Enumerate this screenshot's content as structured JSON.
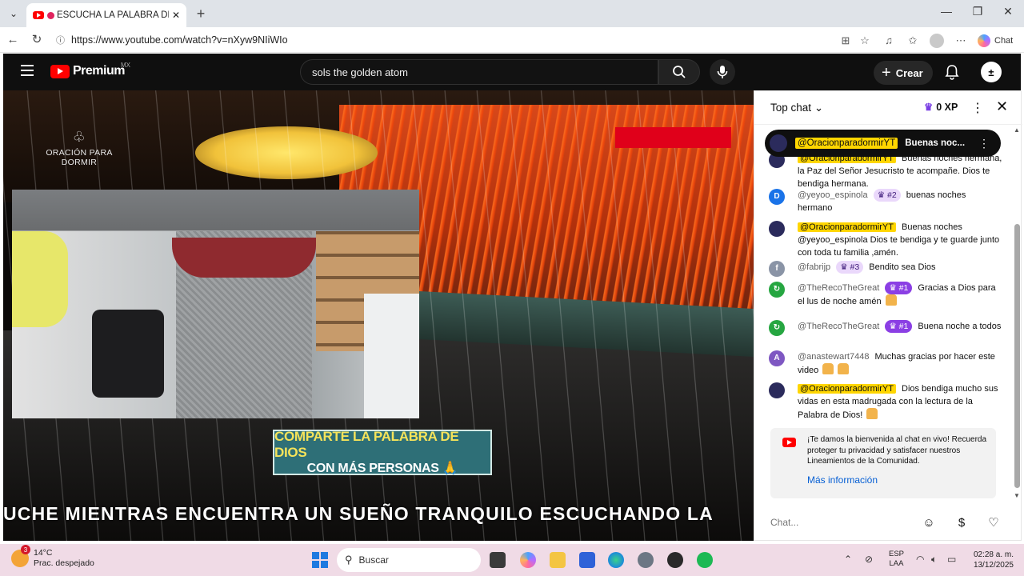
{
  "browser": {
    "tab_title": "ESCUCHA LA PALABRA DE DIOS",
    "tab_close": "✕",
    "new_tab": "+",
    "url": "https://www.youtube.com/watch?v=nXyw9NIiWIo",
    "copilot_label": "Chat"
  },
  "youtube": {
    "brand": "Premium",
    "region": "MX",
    "search_query": "sols the golden atom",
    "create_label": "Crear",
    "account_initial": "±"
  },
  "video": {
    "channel_logo": "ORACIÓN PARA DORMIR",
    "banner_line1": "COMPARTE LA PALABRA DE DIOS",
    "banner_line2": "CON MÁS PERSONAS 🙏",
    "ticker": "UCHE MIENTRAS ENCUENTRA UN SUEÑO TRANQUILO ESCUCHANDO LA"
  },
  "chat": {
    "mode": "Top chat",
    "xp": "0 XP",
    "pinned": {
      "author": "@OracionparadormirYT",
      "text": "Buenas noc..."
    },
    "messages": [
      {
        "author": "@OracionparadormirYT",
        "badge": "",
        "text": "Buenas noches hermana, la Paz del Señor Jesucristo te acompañe. Dios te bendiga hermana.",
        "avatar": "",
        "avatar_color": "#2b2b5c",
        "owner": true
      },
      {
        "author": "@yeyoo_espinola",
        "badge": "#2",
        "text": "buenas noches hermano",
        "avatar": "D",
        "avatar_color": "#1a73e8",
        "owner": false
      },
      {
        "author": "@OracionparadormirYT",
        "badge": "",
        "text": "Buenas noches @yeyoo_espinola Dios te bendiga y te guarde junto con toda tu familia ,amén.",
        "avatar": "",
        "avatar_color": "#2b2b5c",
        "owner": true
      },
      {
        "author": "@fabrijp",
        "badge": "#3",
        "text": "Bendito sea Dios",
        "avatar": "f",
        "avatar_color": "#8a94a6",
        "owner": false
      },
      {
        "author": "@TheRecoTheGreat",
        "badge": "#1",
        "text": "Gracias a Dios para el lus de noche amén",
        "avatar": "",
        "avatar_color": "#26a641",
        "owner": false
      },
      {
        "author": "@TheRecoTheGreat",
        "badge": "#1",
        "text": "Buena noche a todos",
        "avatar": "",
        "avatar_color": "#26a641",
        "owner": false
      },
      {
        "author": "@anastewart7448",
        "badge": "",
        "text": "Muchas gracias por hacer este video",
        "avatar": "A",
        "avatar_color": "#7e57c2",
        "owner": false
      },
      {
        "author": "@OracionparadormirYT",
        "badge": "",
        "text": "Dios bendiga mucho sus vidas en esta madrugada con la lectura de la Palabra de Dios!",
        "avatar": "",
        "avatar_color": "#2b2b5c",
        "owner": true
      }
    ],
    "welcome_text": "¡Te damos la bienvenida al chat en vivo! Recuerda proteger tu privacidad y satisfacer nuestros Lineamientos de la Comunidad.",
    "welcome_link": "Más información",
    "input_placeholder": "Chat..."
  },
  "taskbar": {
    "weather_badge": "3",
    "temperature": "14°C",
    "condition": "Prac. despejado",
    "search_label": "Buscar",
    "lang_line1": "ESP",
    "lang_line2": "LAA",
    "time": "02:28 a. m.",
    "date": "13/12/2025"
  }
}
